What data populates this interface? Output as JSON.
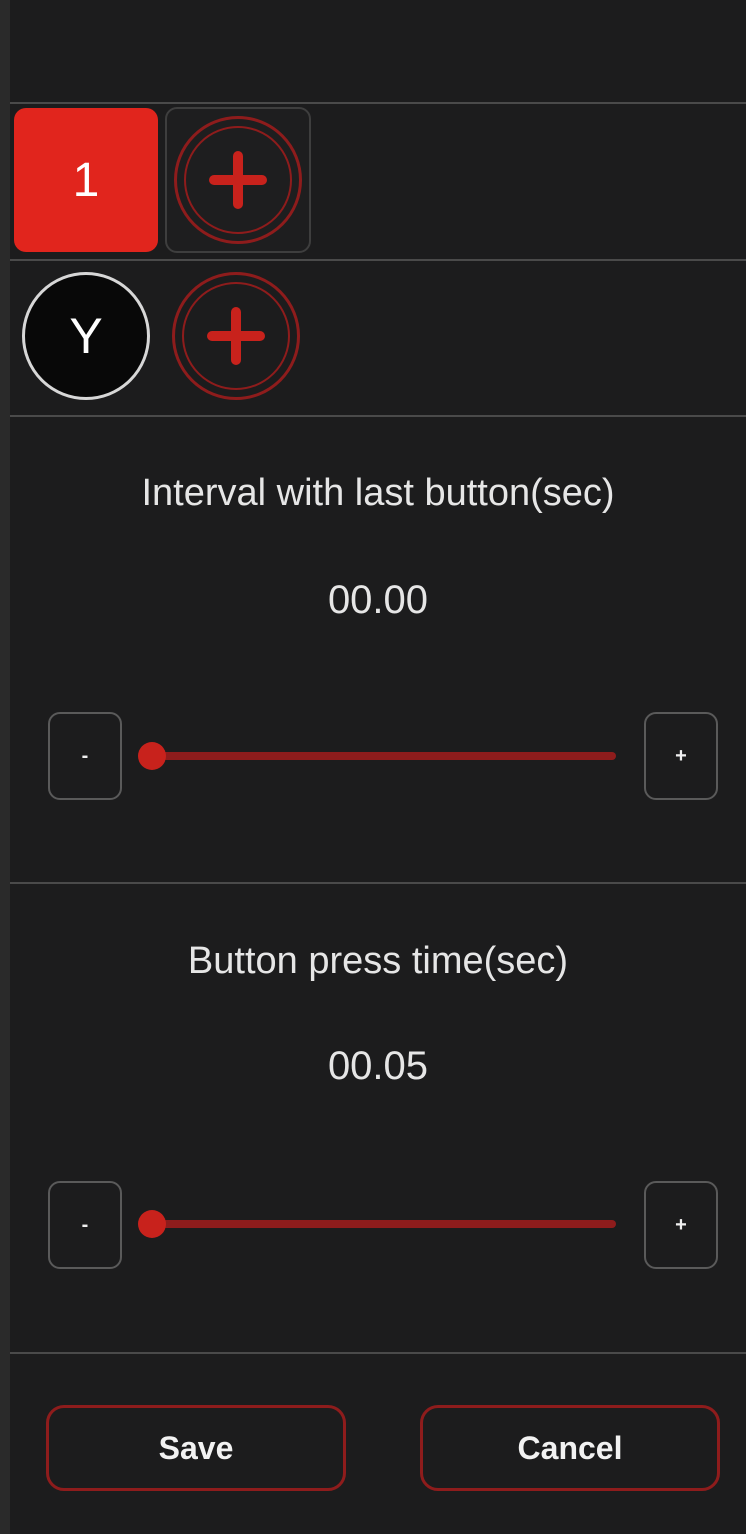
{
  "colors": {
    "accent": "#e1251d",
    "accent_dark": "#8e1c1c",
    "background": "#1c1c1d"
  },
  "sequence": {
    "selected_step_label": "1",
    "add_step_icon": "circle-plus-icon"
  },
  "mapping": {
    "key_label": "Y",
    "add_key_icon": "circle-plus-icon"
  },
  "interval": {
    "title": "Interval with last button(sec)",
    "value": "00.00",
    "slider_fraction": 0.0,
    "decrement_label": "-",
    "increment_label": "+"
  },
  "press_time": {
    "title": "Button press time(sec)",
    "value": "00.05",
    "slider_fraction": 0.0,
    "decrement_label": "-",
    "increment_label": "+"
  },
  "actions": {
    "save_label": "Save",
    "cancel_label": "Cancel"
  }
}
